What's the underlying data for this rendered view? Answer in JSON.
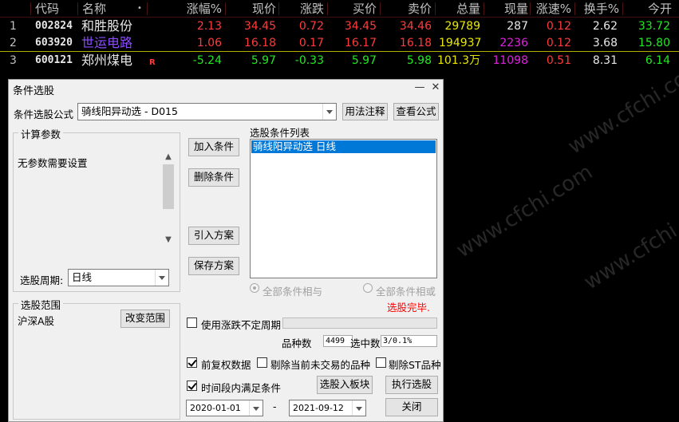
{
  "grid": {
    "headers": [
      "代码",
      "名称",
      "•",
      "涨幅%",
      "现价",
      "涨跌",
      "买价",
      "卖价",
      "总量",
      "现量",
      "涨速%",
      "换手%",
      "今开"
    ],
    "rows": [
      {
        "idx": "1",
        "code": "002824",
        "name": "和胜股份",
        "flag": "",
        "pct": "2.13",
        "price": "34.45",
        "chg": "0.72",
        "bid": "34.45",
        "ask": "34.46",
        "vol": "29789",
        "cur": "287",
        "speed": "0.12",
        "turn": "2.62",
        "open": "33.72"
      },
      {
        "idx": "2",
        "code": "603920",
        "name": "世运电路",
        "flag": "",
        "pct": "1.06",
        "price": "16.18",
        "chg": "0.17",
        "bid": "16.17",
        "ask": "16.18",
        "vol": "194937",
        "cur": "2236",
        "speed": "0.12",
        "turn": "3.68",
        "open": "15.80"
      },
      {
        "idx": "3",
        "code": "600121",
        "name": "郑州煤电",
        "flag": "R",
        "pct": "-5.24",
        "price": "5.97",
        "chg": "-0.33",
        "bid": "5.97",
        "ask": "5.98",
        "vol": "101.3万",
        "cur": "11098",
        "speed": "0.51",
        "turn": "8.31",
        "open": "6.14"
      }
    ]
  },
  "watermark": "www.cfchi.com",
  "dialog": {
    "title": "条件选股",
    "minimize": "—",
    "close": "✕",
    "formula_label": "条件选股公式",
    "formula_value": "骑线阳异动选 - D015",
    "usage_btn": "用法注释",
    "view_btn": "查看公式",
    "params_group": "计算参数",
    "params_text": "无参数需要设置",
    "period_label": "选股周期:",
    "period_value": "日线",
    "add_btn": "加入条件",
    "del_btn": "删除条件",
    "import_btn": "引入方案",
    "save_btn": "保存方案",
    "list_label": "选股条件列表",
    "list_item": "骑线阳异动选  日线",
    "radio_and": "全部条件相与",
    "radio_or": "全部条件相或",
    "status": "选股完毕.",
    "range_group": "选股范围",
    "range_value": "沪深A股",
    "change_range_btn": "改变范围",
    "use_period": "使用涨跌不定周期",
    "count_label": "品种数",
    "count_value": "4499",
    "hit_label": "选中数",
    "hit_value": "3/0.1%",
    "pre_restore": "前复权数据",
    "exclude_untraded": "剔除当前未交易的品种",
    "exclude_st": "剔除ST品种",
    "time_cond": "时间段内满足条件",
    "to_block_btn": "选股入板块",
    "run_btn": "执行选股",
    "date_from": "2020-01-01",
    "date_sep": "-",
    "date_to": "2021-09-12",
    "close_btn": "关闭"
  }
}
